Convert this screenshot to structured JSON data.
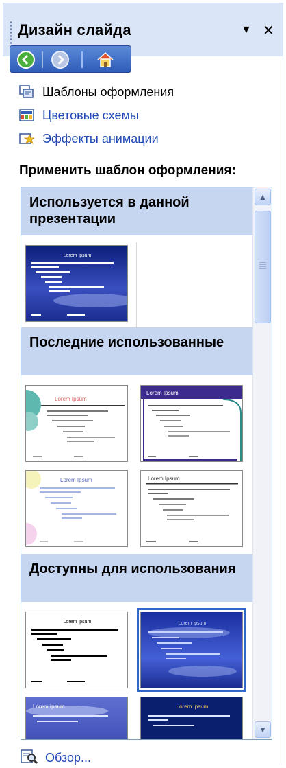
{
  "window": {
    "title": "Дизайн слайда",
    "dropdown_glyph": "▼",
    "close_glyph": "✕"
  },
  "nav": {
    "back_icon": "back-arrow-icon",
    "forward_icon": "forward-arrow-icon",
    "home_icon": "home-icon"
  },
  "task_links": [
    {
      "label": "Шаблоны оформления",
      "icon": "design-templates-icon",
      "is_link": false
    },
    {
      "label": "Цветовые схемы",
      "icon": "color-schemes-icon",
      "is_link": true
    },
    {
      "label": "Эффекты анимации",
      "icon": "animation-effects-icon",
      "is_link": true
    }
  ],
  "apply_label": "Применить шаблон оформления:",
  "groups": [
    {
      "title": "Используется в данной презентации"
    },
    {
      "title": "Последние использованные"
    },
    {
      "title": "Доступны для использования"
    }
  ],
  "thumb_text": "Lorem Ipsum",
  "browse_label": "Обзор...",
  "colors": {
    "header_bg": "#dbe5f8",
    "group_bg": "#c6d5f0",
    "link": "#2147b3",
    "selection": "#3167c6"
  }
}
